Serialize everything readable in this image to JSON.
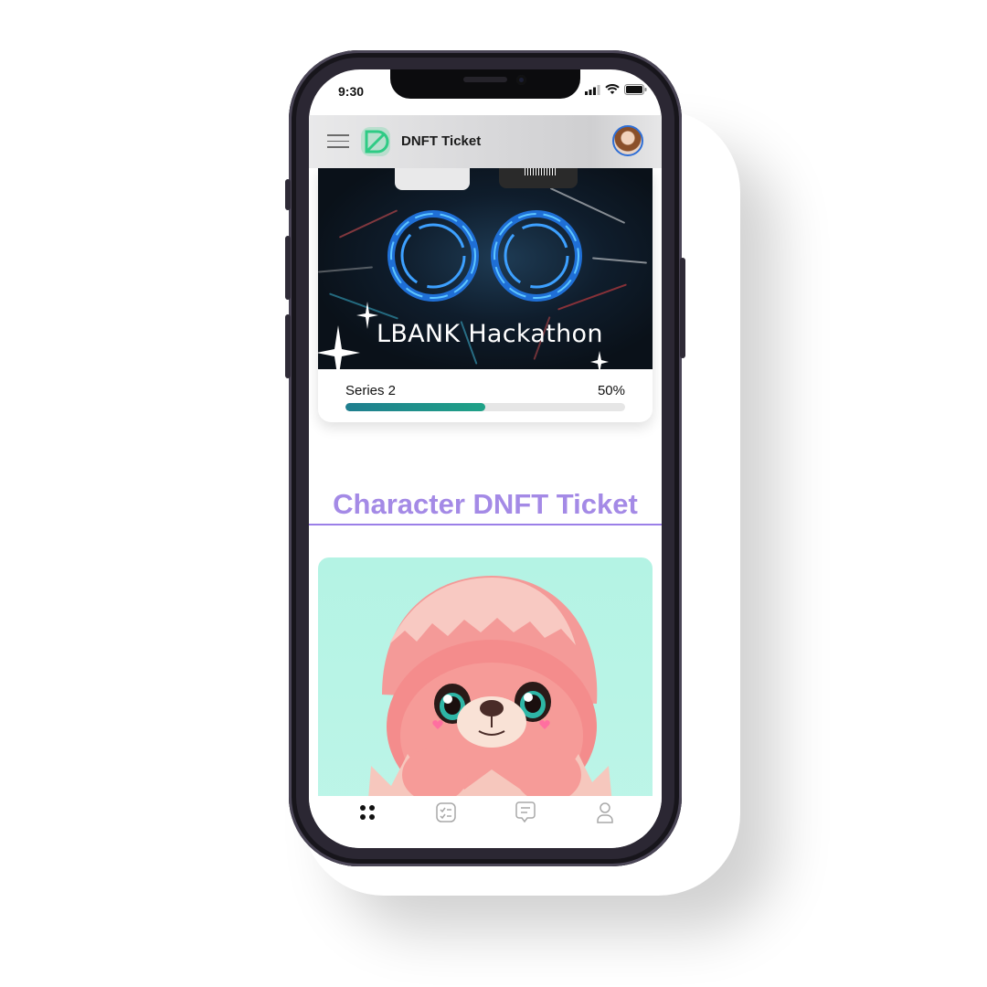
{
  "status_bar": {
    "time": "9:30",
    "icons": [
      "signal-icon",
      "wifi-icon",
      "battery-icon"
    ]
  },
  "header": {
    "title": "DNFT Ticket",
    "menu_icon": "menu-icon",
    "logo_icon": "dnft-logo-icon",
    "avatar": "user-avatar"
  },
  "event_card": {
    "title": "LBANK Hackathon",
    "progress_label": "Series 2",
    "progress_text": "50%",
    "progress_fraction": 0.5
  },
  "section": {
    "title": "Character DNFT Ticket"
  },
  "bottom_nav": {
    "items": [
      {
        "icon": "grid-dots-icon",
        "active": true
      },
      {
        "icon": "checklist-icon",
        "active": false
      },
      {
        "icon": "chat-icon",
        "active": false
      },
      {
        "icon": "profile-icon",
        "active": false
      }
    ]
  },
  "colors": {
    "accent_title": "#a48ae6",
    "progress_start": "#1f7e8f",
    "progress_end": "#1fa287",
    "character_bg": "#b4f3e4",
    "avatar_border": "#2f6fd6"
  }
}
